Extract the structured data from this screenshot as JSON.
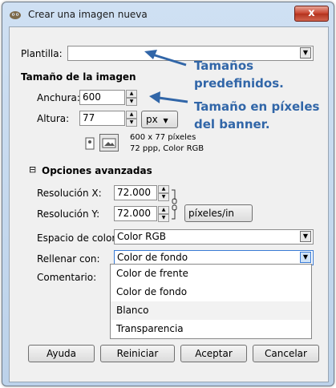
{
  "window": {
    "title": "Crear una imagen nueva",
    "close_label": "x"
  },
  "template": {
    "label": "Plantilla:",
    "value": ""
  },
  "image_size": {
    "heading": "Tamaño de la imagen",
    "width_label": "Anchura:",
    "width_value": "600",
    "height_label": "Altura:",
    "height_value": "77",
    "unit": "px",
    "info_line1": "600 x 77 píxeles",
    "info_line2": "72 ppp, Color RGB"
  },
  "annotations": {
    "predefined_line1": "Tamaños",
    "predefined_line2": "predefinidos.",
    "pixel_line1": "Tamaño en píxeles",
    "pixel_line2": "del banner."
  },
  "advanced": {
    "toggle": "⊟",
    "heading": "Opciones avanzadas",
    "res_x_label": "Resolución X:",
    "res_x_value": "72.000",
    "res_y_label": "Resolución Y:",
    "res_y_value": "72.000",
    "res_unit": "píxeles/in",
    "colorspace_label": "Espacio de color:",
    "colorspace_value": "Color RGB",
    "fill_label": "Rellenar con:",
    "fill_value": "Color de fondo",
    "comment_label": "Comentario:"
  },
  "fill_options": [
    "Color de frente",
    "Color de fondo",
    "Blanco",
    "Transparencia"
  ],
  "buttons": {
    "help": "Ayuda",
    "reset": "Reiniciar",
    "ok": "Aceptar",
    "cancel": "Cancelar"
  },
  "colors": {
    "annotation": "#3166a8",
    "dialog_bg": "#f0f0f0"
  }
}
